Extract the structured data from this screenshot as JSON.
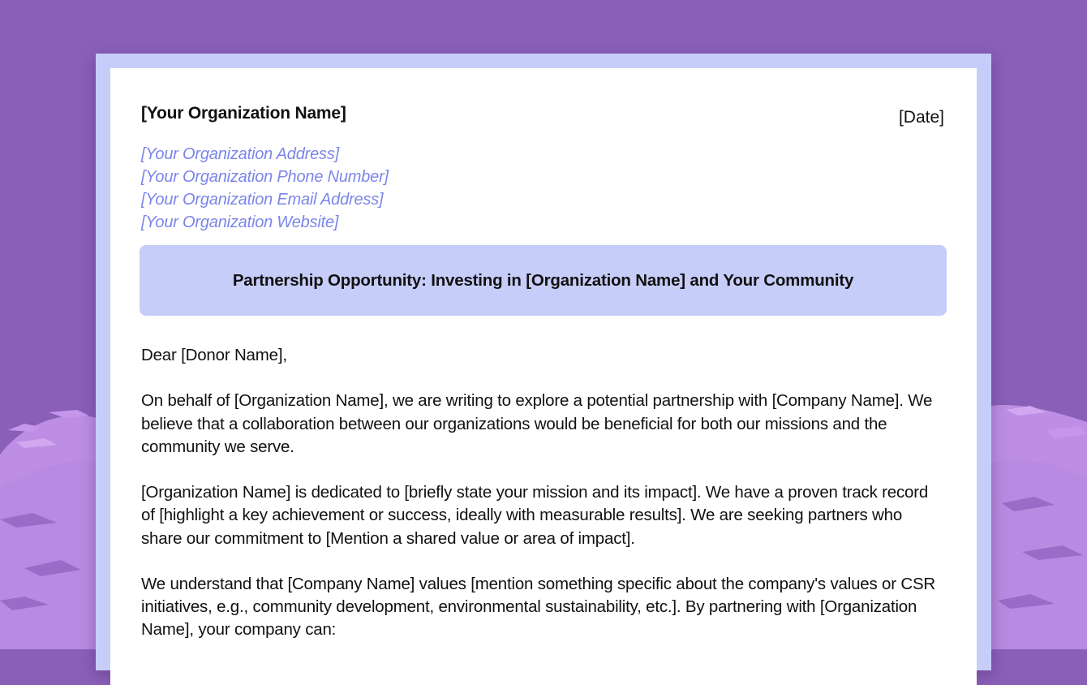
{
  "letter": {
    "org_name": "[Your Organization Name]",
    "date": "[Date]",
    "contact": {
      "address": "[Your Organization Address]",
      "phone": "[Your Organization Phone Number]",
      "email": "[Your Organization Email Address]",
      "website": "[Your Organization Website]"
    },
    "subject": "Partnership Opportunity: Investing in [Organization Name] and Your Community",
    "greeting": "Dear [Donor Name],",
    "paragraphs": [
      "On behalf of [Organization Name], we are writing to explore a potential partnership with [Company Name]. We believe that a collaboration between our organizations would be beneficial for both our missions and the community we serve.",
      "[Organization Name] is dedicated to [briefly state your mission and its impact]. We have a proven track record of [highlight a key achievement or success, ideally with measurable results]. We are seeking partners who share our commitment to [Mention a shared value or area of impact].",
      "We understand that [Company Name] values [mention something specific about the company's values or CSR initiatives, e.g., community development, environmental sustainability, etc.]. By partnering with [Organization Name], your company can:"
    ]
  },
  "colors": {
    "background": "#8a5fb8",
    "texture": "#c596ea",
    "paper_border": "#c7cdf9",
    "subject_box": "#c7cdf9",
    "contact_text": "#7b86e8",
    "text": "#111111"
  }
}
